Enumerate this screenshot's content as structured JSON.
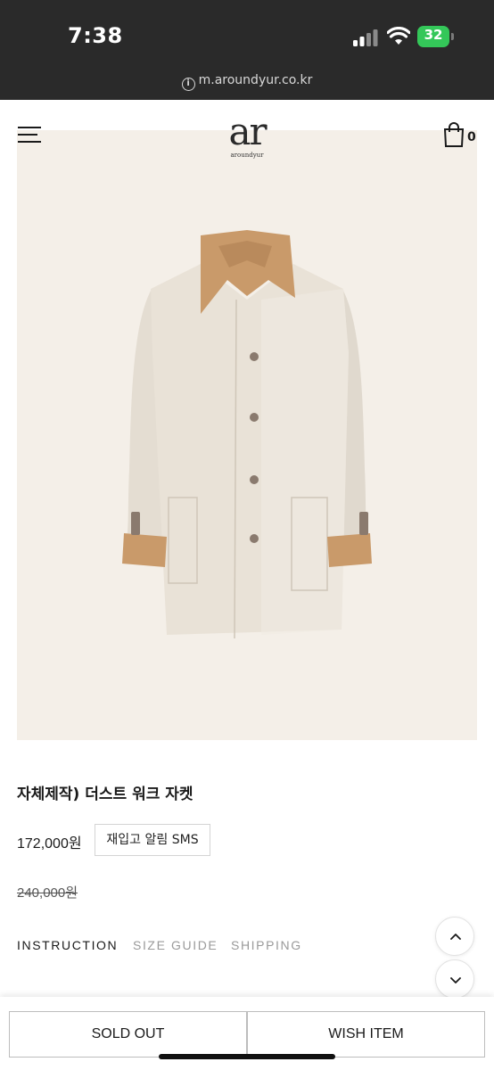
{
  "status_bar": {
    "time": "7:38",
    "battery": "32",
    "icons": [
      "signal-icon",
      "wifi-icon",
      "battery-icon"
    ]
  },
  "browser": {
    "url": "m.aroundyur.co.kr",
    "url_icon": "info-icon"
  },
  "header": {
    "logo_mark": "ar",
    "logo_sub": "aroundyur",
    "cart_count": "0",
    "icons": [
      "menu-icon",
      "shopping-bag-icon"
    ]
  },
  "product": {
    "title": "자체제작) 더스트 워크 자켓",
    "price": "172,000원",
    "restock_label": "재입고 알림 SMS",
    "original_price": "240,000원",
    "colors": {
      "background": "#f4efe8",
      "jacket_body": "#e8e1d6",
      "collar_cuff": "#c99a6a",
      "button": "#8a7a6e"
    }
  },
  "tabs": [
    {
      "label": "INSTRUCTION",
      "active": true
    },
    {
      "label": "SIZE GUIDE",
      "active": false
    },
    {
      "label": "SHIPPING",
      "active": false
    }
  ],
  "scroll": {
    "icons": [
      "chevron-up-icon",
      "chevron-down-icon"
    ]
  },
  "bottom_bar": {
    "soldout_label": "SOLD OUT",
    "wish_label": "WISH ITEM"
  }
}
